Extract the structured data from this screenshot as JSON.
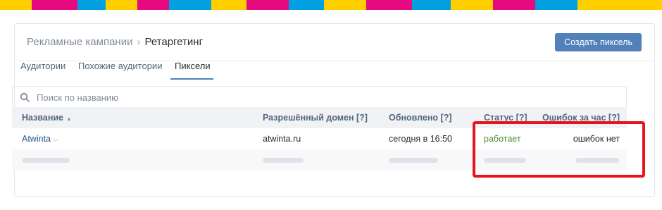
{
  "colors": {
    "stripe": [
      "#ffcf00",
      "#e6097f",
      "#00a0e3",
      "#ffcf00",
      "#e6097f",
      "#00a0e3",
      "#ffcf00",
      "#e6097f",
      "#00a0e3",
      "#ffcf00",
      "#e6097f",
      "#00a0e3",
      "#ffcf00",
      "#e6097f",
      "#00a0e3",
      "#ffcf00"
    ],
    "accent": "#5181b8",
    "status_ok": "#4a8a2f",
    "highlight": "#e8131d"
  },
  "breadcrumb": {
    "parent": "Рекламные кампании",
    "separator": "›",
    "current": "Ретаргетинг"
  },
  "header": {
    "create_button": "Создать пиксель"
  },
  "tabs": [
    {
      "label": "Аудитории",
      "active": false
    },
    {
      "label": "Похожие аудитории",
      "active": false
    },
    {
      "label": "Пиксели",
      "active": true
    }
  ],
  "search": {
    "placeholder": "Поиск по названию",
    "value": ""
  },
  "table": {
    "columns": {
      "name": "Название",
      "domain": "Разрешённый домен [?]",
      "updated": "Обновлено [?]",
      "status": "Статус [?]",
      "errors": "Ошибок за час [?]"
    },
    "rows": [
      {
        "name": "Atwinta",
        "domain": "atwinta.ru",
        "updated": "сегодня в 16:50",
        "status": "работает",
        "errors": "ошибок нет"
      }
    ]
  },
  "icons": {
    "search": "search-icon",
    "sort": "sort-asc-icon",
    "row_menu": "chevron-down-icon"
  }
}
